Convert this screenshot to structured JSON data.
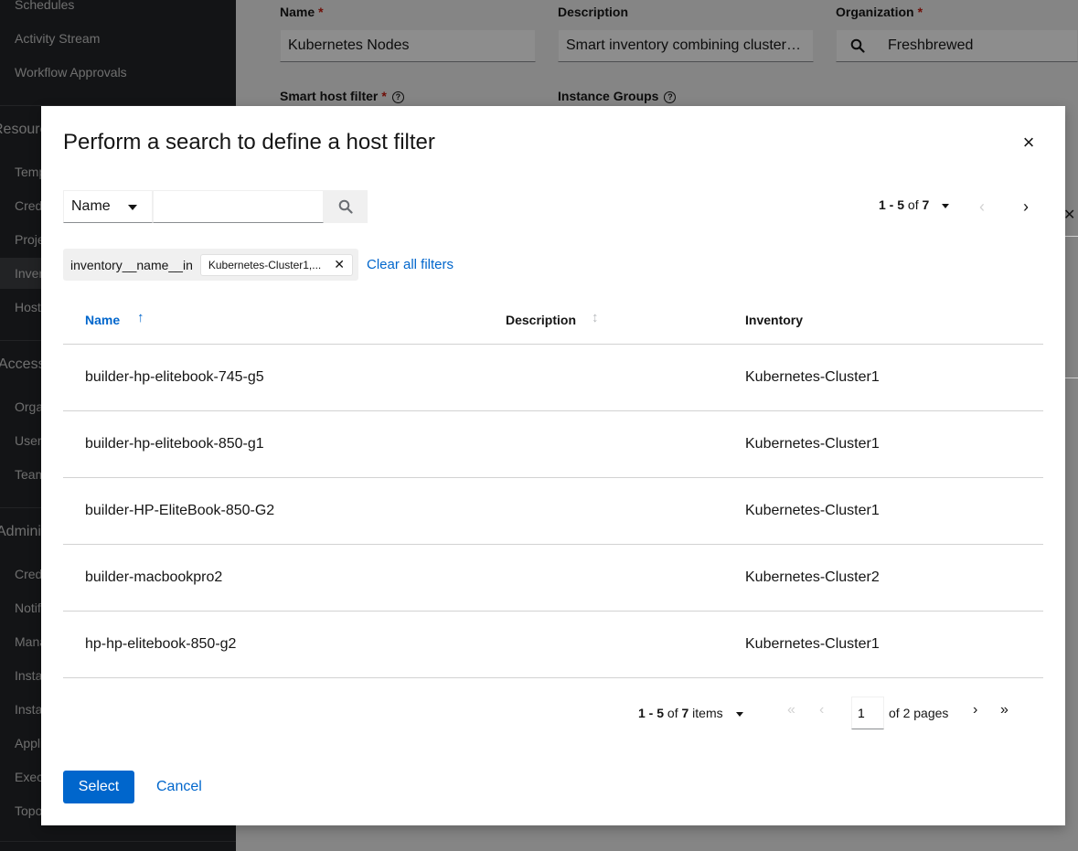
{
  "sidebar": {
    "items": [
      {
        "label": "Schedules"
      },
      {
        "label": "Activity Stream"
      },
      {
        "label": "Workflow Approvals"
      },
      {
        "label": "Templates"
      },
      {
        "label": "Credentials"
      },
      {
        "label": "Projects"
      },
      {
        "label": "Inventories"
      },
      {
        "label": "Hosts"
      },
      {
        "label": "Organizations"
      },
      {
        "label": "Users"
      },
      {
        "label": "Teams"
      },
      {
        "label": "Credential Types"
      },
      {
        "label": "Notifications"
      },
      {
        "label": "Management Jobs"
      },
      {
        "label": "Instance Groups"
      },
      {
        "label": "Instances"
      },
      {
        "label": "Applications"
      },
      {
        "label": "Execution Environments"
      },
      {
        "label": "Topology View"
      }
    ],
    "groups": [
      {
        "label": "Resources"
      },
      {
        "label": "Access"
      },
      {
        "label": "Administration"
      }
    ]
  },
  "form": {
    "name_label": "Name",
    "name_value": "Kubernetes Nodes",
    "description_label": "Description",
    "description_value": "Smart inventory combining cluster1...",
    "organization_label": "Organization",
    "organization_value": "Freshbrewed",
    "smart_host_filter_label": "Smart host filter",
    "instance_groups_label": "Instance Groups"
  },
  "modal": {
    "title": "Perform a search to define a host filter",
    "search": {
      "attribute": "Name",
      "value": ""
    },
    "pager_top": {
      "range": "1 - 5",
      "of_text": "of",
      "total": "7"
    },
    "filter": {
      "category": "inventory__name__in",
      "chip": "Kubernetes-Cluster1,..."
    },
    "clear_filters": "Clear all filters",
    "columns": {
      "name": "Name",
      "description": "Description",
      "inventory": "Inventory"
    },
    "rows": [
      {
        "name": "builder-hp-elitebook-745-g5",
        "description": "",
        "inventory": "Kubernetes-Cluster1"
      },
      {
        "name": "builder-hp-elitebook-850-g1",
        "description": "",
        "inventory": "Kubernetes-Cluster1"
      },
      {
        "name": "builder-HP-EliteBook-850-G2",
        "description": "",
        "inventory": "Kubernetes-Cluster1"
      },
      {
        "name": "builder-macbookpro2",
        "description": "",
        "inventory": "Kubernetes-Cluster2"
      },
      {
        "name": "hp-hp-elitebook-850-g2",
        "description": "",
        "inventory": "Kubernetes-Cluster1"
      }
    ],
    "pager_bottom": {
      "range": "1 - 5",
      "of_text": "of",
      "total": "7",
      "items_text": "items",
      "page": "1",
      "of_pages": "of 2 pages"
    },
    "select_label": "Select",
    "cancel_label": "Cancel"
  },
  "icons": {
    "close": "close-icon",
    "search": "search-icon",
    "sort_up": "arrow-up-icon",
    "sort": "sort-icon",
    "help": "question-circle-icon"
  }
}
